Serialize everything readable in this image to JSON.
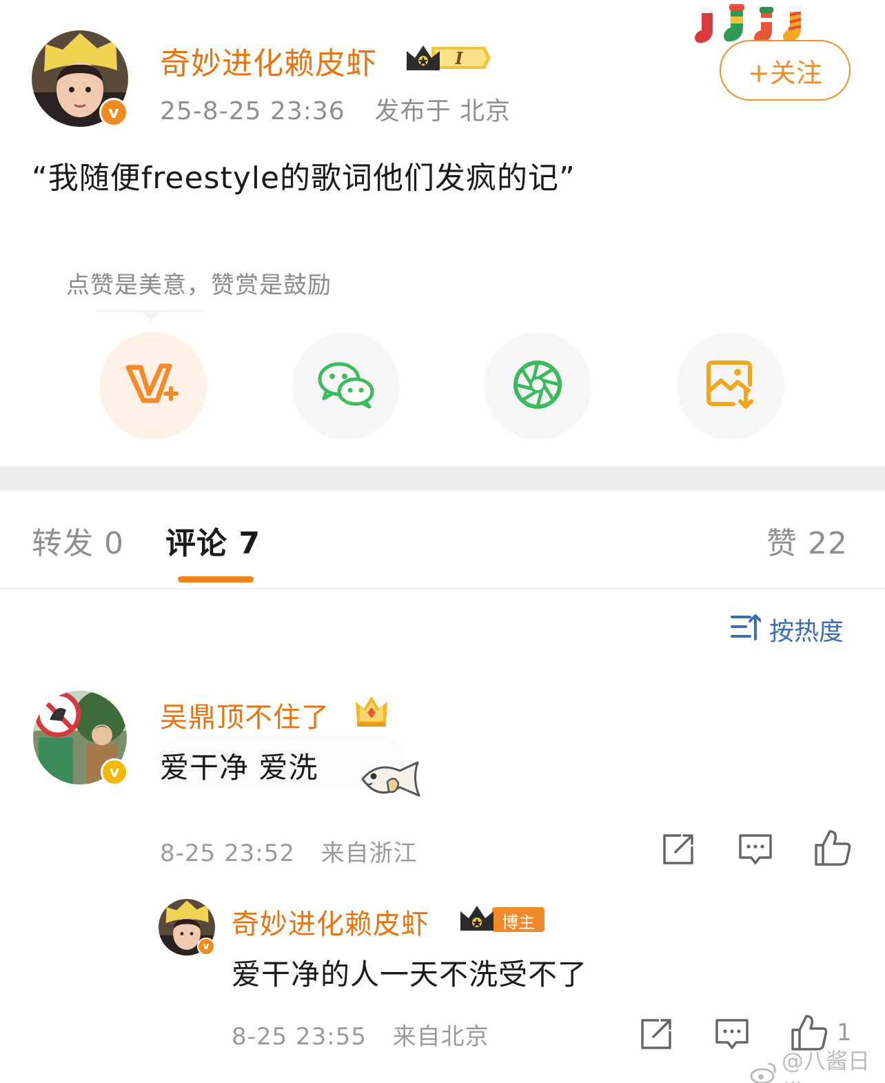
{
  "post": {
    "author": "奇妙进化赖皮虾",
    "level_badge": "I",
    "date": "25-8-25 23:36",
    "location": "发布于 北京",
    "follow_label": "+关注",
    "text": "“我随便freestyle的歌词他们发疯的记”"
  },
  "reward_tip": "点赞是美意，赞赏是鼓励",
  "share_icons": [
    "vip-plus-icon",
    "wechat-icon",
    "moments-icon",
    "save-image-icon"
  ],
  "tabs": {
    "repost": "转发 0",
    "comments": "评论 7",
    "likes": "赞 22"
  },
  "sort_label": "按热度",
  "comments": [
    {
      "user": "吴鼎顶不住了",
      "text": "爱干净 爱洗",
      "time": "8-25 23:52",
      "from": "来自浙江",
      "likes": ""
    }
  ],
  "reply": {
    "user": "奇妙进化赖皮虾",
    "badge": "博主",
    "text": "爱干净的人一天不洗受不了",
    "time": "8-25 23:55",
    "from": "来自北京",
    "likes": "1"
  },
  "watermark": "@八酱日常",
  "colors": {
    "accent_orange": "#e8730f",
    "follow_orange": "#f08d2a",
    "tab_underline": "#f08319",
    "sort_blue": "#3c6db8",
    "wechat_green": "#3dba5b",
    "verified_orange": "#f08a1d",
    "verified_yellow": "#f5b800"
  }
}
